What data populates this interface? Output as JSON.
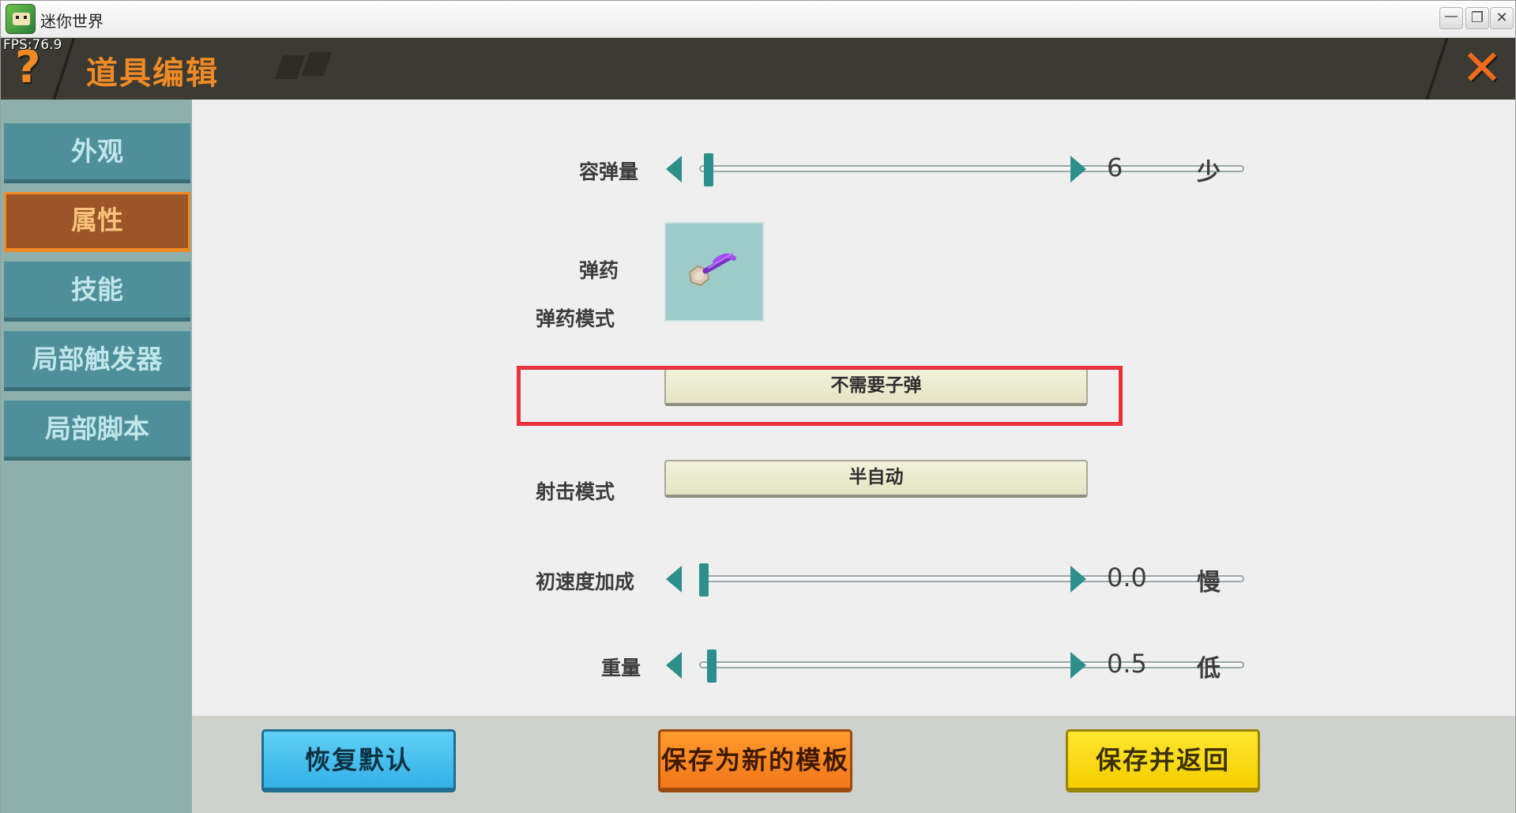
{
  "window": {
    "title": "迷你世界",
    "minimize": "—",
    "restore": "❐",
    "close": "✕"
  },
  "fps": "FPS:76.9",
  "header": {
    "help": "?",
    "title": "道具编辑",
    "close": "✕"
  },
  "sidebar": {
    "items": [
      {
        "label": "外观",
        "active": false
      },
      {
        "label": "属性",
        "active": true
      },
      {
        "label": "技能",
        "active": false
      },
      {
        "label": "局部触发器",
        "active": false
      },
      {
        "label": "局部脚本",
        "active": false
      }
    ]
  },
  "settings": {
    "capacity": {
      "label": "容弹量",
      "value": "6",
      "desc": "少"
    },
    "ammo": {
      "label": "弹药",
      "icon": "ammo-item-icon"
    },
    "ammo_mode": {
      "label": "弹药模式",
      "value": "不需要子弹"
    },
    "fire_mode": {
      "label": "射击模式",
      "value": "半自动"
    },
    "velocity": {
      "label": "初速度加成",
      "value": "0.0",
      "desc": "慢"
    },
    "weight": {
      "label": "重量",
      "value": "0.5",
      "desc": "低"
    }
  },
  "buttons": {
    "reset": "恢复默认",
    "save_template": "保存为新的模板",
    "save_return": "保存并返回"
  },
  "colors": {
    "accent_orange": "#f08a25",
    "teal": "#2d8f8c",
    "highlight_red": "#e8323c"
  }
}
